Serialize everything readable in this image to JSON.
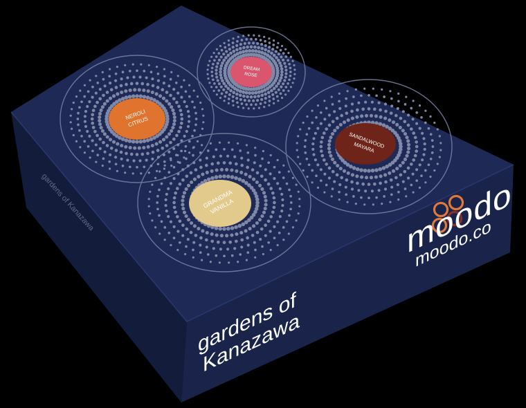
{
  "product": {
    "brand_logo": "moodo",
    "website": "moodo.co",
    "collection_line1": "gardens of",
    "collection_line2": "Kanazawa",
    "left_side_text": "gardens of Kanazawa"
  },
  "capsules": [
    {
      "line1": "DREAM",
      "line2": "ROSE",
      "color": "#d9566e"
    },
    {
      "line1": "NEROLI",
      "line2": "CITRUS",
      "color": "#e0742e"
    },
    {
      "line1": "SANDALWOOD",
      "line2": "MAYARA",
      "color": "#6e2418"
    },
    {
      "line1": "GRANDMA",
      "line2": "VANILLA",
      "color": "#e2c98c"
    }
  ],
  "colors": {
    "box_top": "#1e2a55",
    "box_front": "#1a244b",
    "box_side": "#141c3c",
    "dots": "#8088a8",
    "logo_orange": "#e07a3a",
    "logo_white": "#ffffff",
    "background": "#000000"
  }
}
